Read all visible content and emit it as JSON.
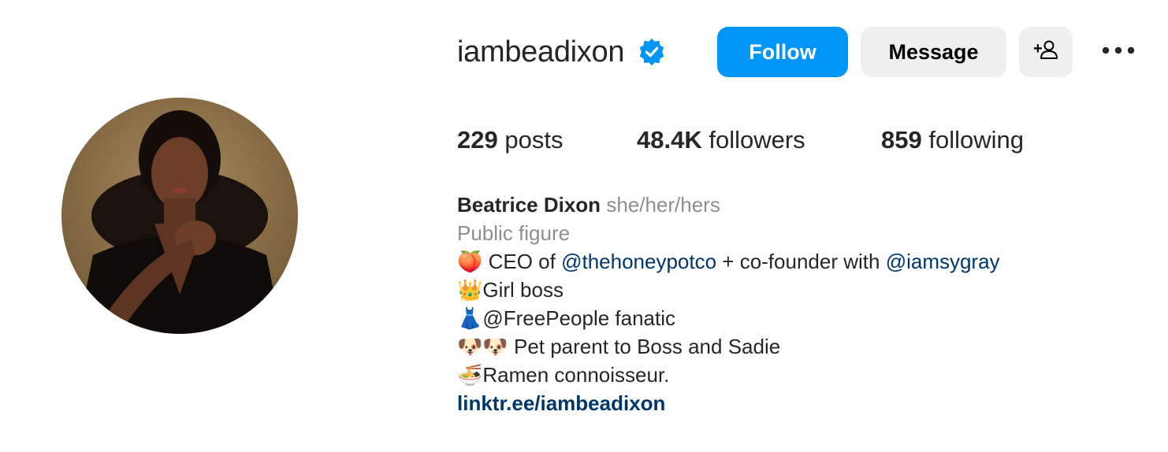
{
  "profile": {
    "username": "iambeadixon",
    "verified": true,
    "avatar_alt": "profile-photo"
  },
  "actions": {
    "follow_label": "Follow",
    "message_label": "Message",
    "suggest_icon": "add-person-icon",
    "more_icon": "more-options-icon"
  },
  "stats": {
    "posts_count": "229",
    "posts_label": " posts",
    "followers_count": "48.4K",
    "followers_label": " followers",
    "following_count": "859",
    "following_label": " following"
  },
  "bio": {
    "full_name": "Beatrice Dixon",
    "pronouns": "she/her/hers",
    "category": "Public figure",
    "line1_emoji": "🍑",
    "line1_text_a": " CEO of ",
    "line1_mention1": "@thehoneypotco",
    "line1_text_b": " + co-founder with ",
    "line1_mention2": "@iamsygray",
    "line2_emoji": "👑",
    "line2_text": "Girl boss",
    "line3_emoji": "👗",
    "line3_text": "@FreePeople fanatic",
    "line4_emoji": "🐶🐶",
    "line4_text": " Pet parent to Boss and Sadie",
    "line5_emoji": "🍜",
    "line5_text": "Ramen connoisseur.",
    "link": "linktr.ee/iambeadixon"
  },
  "colors": {
    "follow_blue": "#0095f6",
    "secondary_button": "#efefef",
    "mention_link": "#00376b",
    "muted_text": "#8e8e8e",
    "verified_badge": "#0095f6"
  }
}
